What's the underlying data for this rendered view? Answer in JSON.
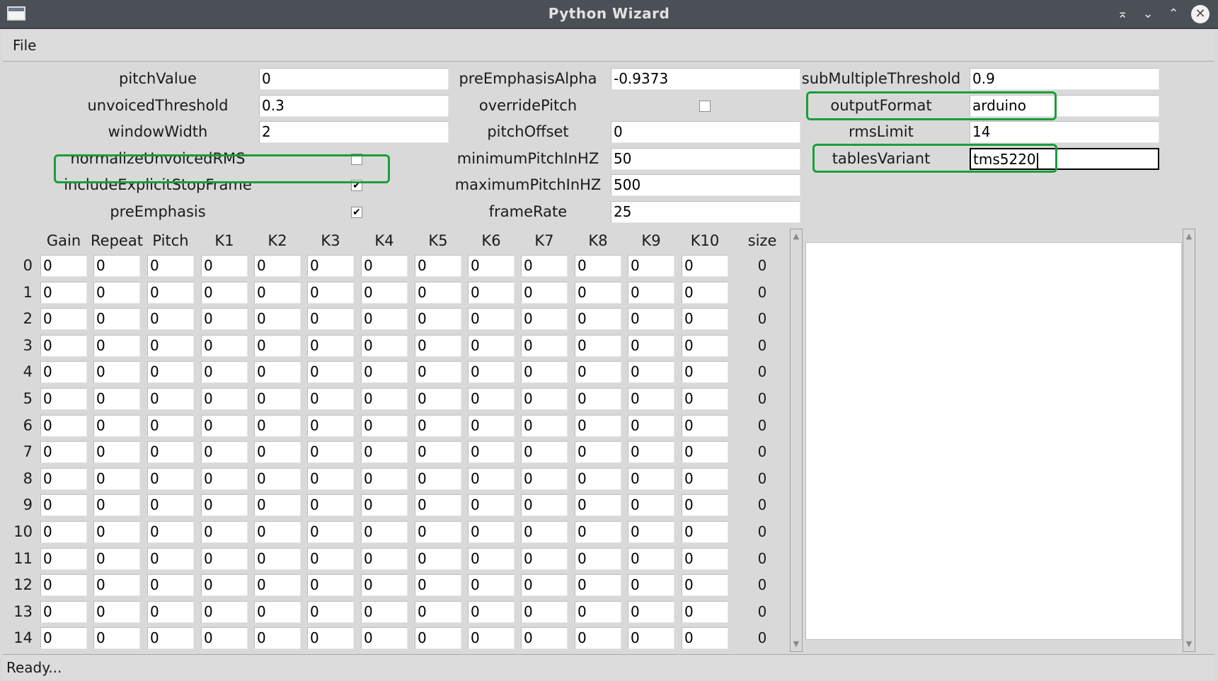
{
  "window": {
    "title": "Python Wizard"
  },
  "menu": {
    "file": "File"
  },
  "params": {
    "col1": [
      {
        "label": "pitchValue",
        "type": "field",
        "value": "0"
      },
      {
        "label": "unvoicedThreshold",
        "type": "field",
        "value": "0.3"
      },
      {
        "label": "windowWidth",
        "type": "field",
        "value": "2"
      },
      {
        "label": "normalizeUnvoicedRMS",
        "type": "check",
        "checked": false
      },
      {
        "label": "includeExplicitStopFrame",
        "type": "check",
        "checked": true
      },
      {
        "label": "preEmphasis",
        "type": "check",
        "checked": true
      }
    ],
    "col2": [
      {
        "label": "preEmphasisAlpha",
        "type": "field",
        "value": "-0.9373"
      },
      {
        "label": "overridePitch",
        "type": "check",
        "checked": false
      },
      {
        "label": "pitchOffset",
        "type": "field",
        "value": "0"
      },
      {
        "label": "minimumPitchInHZ",
        "type": "field",
        "value": "50"
      },
      {
        "label": "maximumPitchInHZ",
        "type": "field",
        "value": "500"
      },
      {
        "label": "frameRate",
        "type": "field",
        "value": "25"
      }
    ],
    "col3": [
      {
        "label": "subMultipleThreshold",
        "type": "field",
        "value": "0.9"
      },
      {
        "label": "outputFormat",
        "type": "field",
        "value": "arduino"
      },
      {
        "label": "rmsLimit",
        "type": "field",
        "value": "14"
      },
      {
        "label": "tablesVariant",
        "type": "field",
        "value": "tms5220"
      }
    ]
  },
  "table": {
    "headers": [
      "Gain",
      "Repeat",
      "Pitch",
      "K1",
      "K2",
      "K3",
      "K4",
      "K5",
      "K6",
      "K7",
      "K8",
      "K9",
      "K10",
      "size"
    ],
    "row_labels": [
      "0",
      "1",
      "2",
      "3",
      "4",
      "5",
      "6",
      "7",
      "8",
      "9",
      "10",
      "11",
      "12",
      "13",
      "14"
    ],
    "cell_value": "0",
    "size_value": "0"
  },
  "status": {
    "text": "Ready..."
  },
  "colors": {
    "highlight": "#1a9e3a",
    "titlebar": "#4a5056"
  }
}
